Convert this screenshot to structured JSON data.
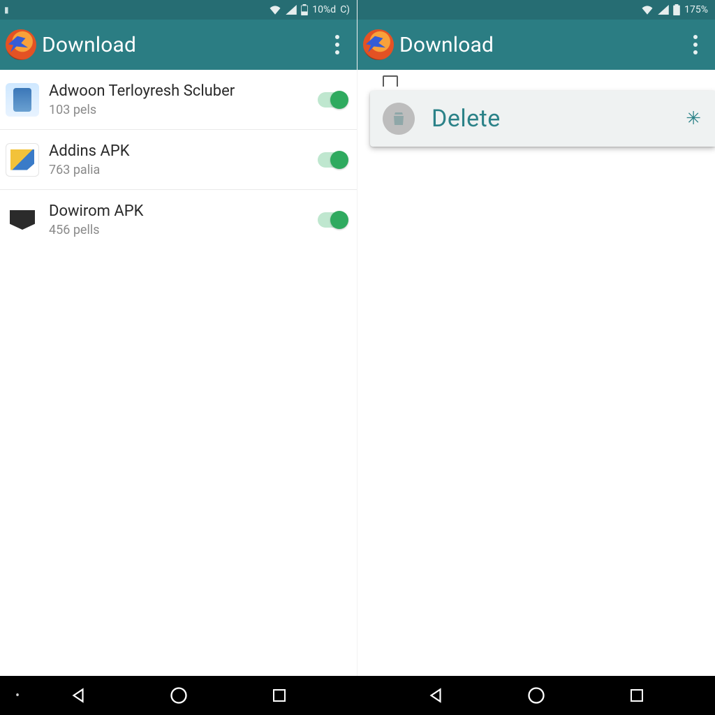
{
  "left": {
    "status": {
      "battery_text": "10%d",
      "extra_glyph": "C)"
    },
    "appbar": {
      "title": "Download"
    },
    "items": [
      {
        "title": "Adwoon Terloyresh Scluber",
        "sub": "103 pels",
        "icon": "app1"
      },
      {
        "title": "Addins APK",
        "sub": "763 palia",
        "icon": "app2"
      },
      {
        "title": "Dowirom APK",
        "sub": "456 pells",
        "icon": "app3"
      }
    ]
  },
  "right": {
    "status": {
      "battery_text": "175%"
    },
    "appbar": {
      "title": "Download"
    },
    "peek": {
      "label": ""
    },
    "delete": {
      "label": "Delete",
      "close_glyph": "✳"
    }
  }
}
